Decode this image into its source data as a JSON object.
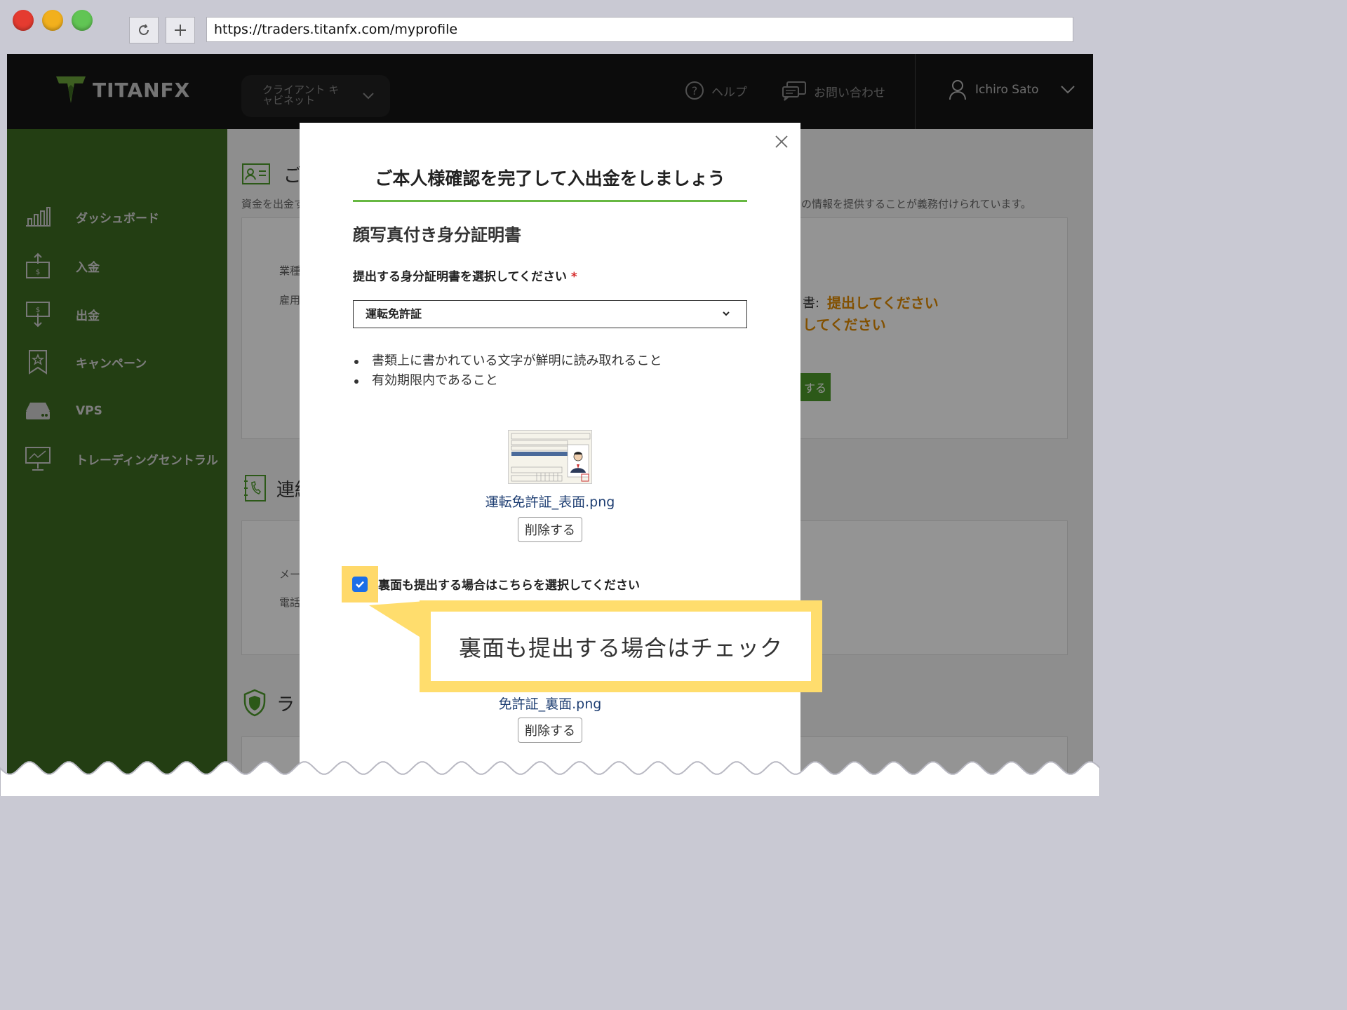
{
  "browser": {
    "url": "https://traders.titanfx.com/myprofile"
  },
  "header": {
    "logo_text": "TITANFX",
    "cabinet_label": "クライアント キャビネット",
    "help_label": "ヘルプ",
    "contact_label": "お問い合わせ",
    "user_name": "Ichiro Sato"
  },
  "sidebar": {
    "items": [
      {
        "label": "ダッシュボード",
        "icon": "chart-bars-icon"
      },
      {
        "label": "入金",
        "icon": "deposit-icon"
      },
      {
        "label": "出金",
        "icon": "withdraw-icon"
      },
      {
        "label": "キャンペーン",
        "icon": "campaign-star-icon"
      },
      {
        "label": "VPS",
        "icon": "server-icon"
      },
      {
        "label": "トレーディングセントラル",
        "icon": "monitor-chart-icon"
      }
    ]
  },
  "background": {
    "section1_title": "ご",
    "section1_desc_left": "資金を出金す",
    "section1_desc_right": "の情報を提供することが義務付けられています。",
    "field_job": "業種",
    "field_employment": "雇用",
    "doc_prefix": "書:",
    "doc_status_1": "提出してください",
    "doc_status_2": "してください",
    "green_button_fragment": "する",
    "section2_title": "連絡",
    "field_mail": "メー",
    "field_phone": "電話",
    "section3_title": "ラ"
  },
  "modal": {
    "title": "ご本人様確認を完了して入出金をしましょう",
    "subtitle": "顔写真付き身分証明書",
    "select_label": "提出する身分証明書を選択してください",
    "required_mark": "*",
    "selected_document": "運転免許証",
    "requirements": [
      "書類上に書かれている文字が鮮明に読み取れること",
      "有効期限内であること"
    ],
    "front_file_name": "運転免許証_表面.png",
    "delete_label": "削除する",
    "back_checkbox_label": "裏面も提出する場合はこちらを選択してください",
    "back_checkbox_checked": true,
    "back_file_name": "免許証_裏面.png"
  },
  "callout": {
    "text": "裏面も提出する場合はチェック"
  },
  "colors": {
    "sidebar_green": "#3d6b21",
    "accent_green": "#67b842",
    "status_orange": "#e08a00",
    "callout_yellow": "#ffdd6d",
    "checkbox_blue": "#1b6ee8"
  }
}
